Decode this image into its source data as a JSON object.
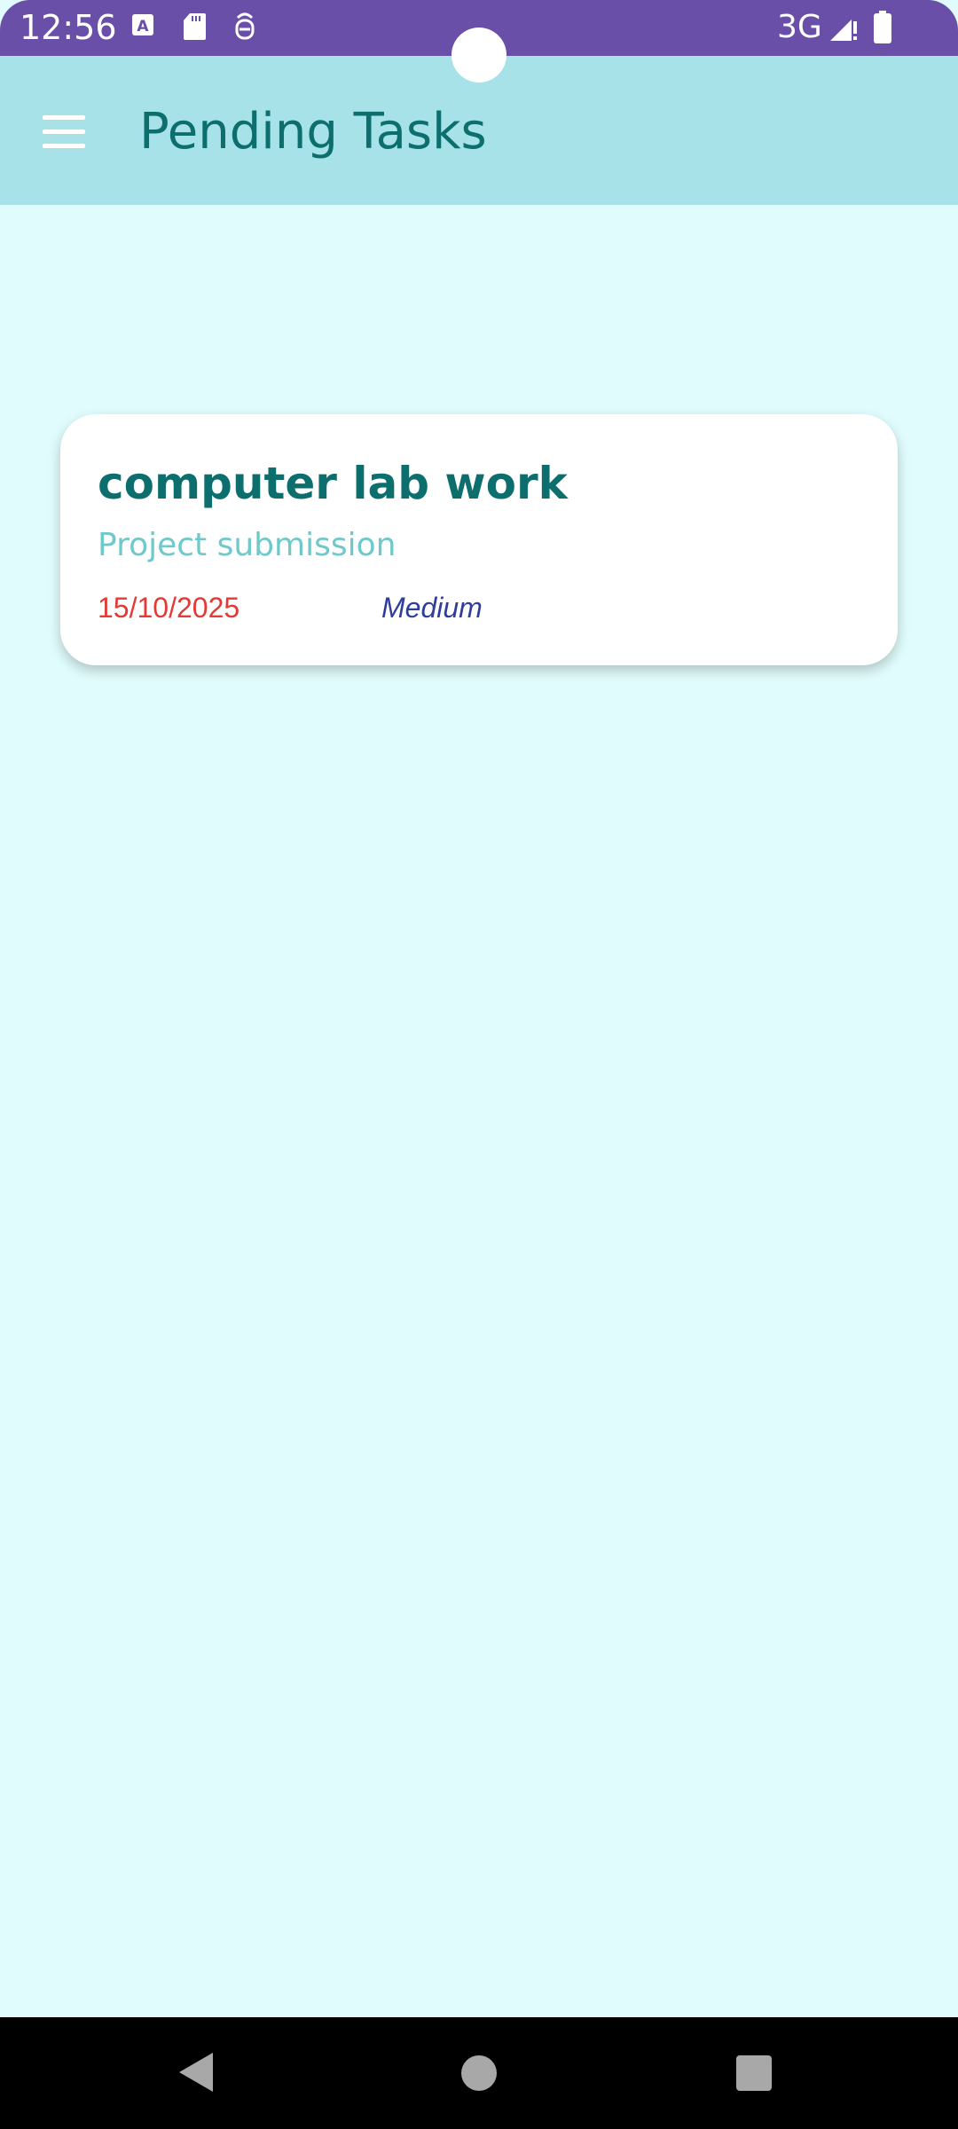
{
  "status_bar": {
    "time": "12:56",
    "network": "3G",
    "icons": [
      "accessibility-icon",
      "sd-card-icon",
      "debug-icon",
      "signal-icon",
      "battery-icon"
    ],
    "color": "#6a4fa8"
  },
  "app_bar": {
    "title": "Pending Tasks",
    "menu_icon": "hamburger-menu-icon",
    "color": "#a6e2e8"
  },
  "tasks": [
    {
      "title": "computer lab work",
      "description": "Project submission",
      "due_date": "15/10/2025",
      "priority": "Medium"
    }
  ],
  "colors": {
    "background": "#e0fcfc",
    "title_text": "#0d6e6e",
    "description_text": "#6fc9cb",
    "date_text": "#e53935",
    "priority_text": "#2e3d9e"
  },
  "nav_bar": {
    "icons": [
      "back-icon",
      "home-icon",
      "recents-icon"
    ]
  }
}
